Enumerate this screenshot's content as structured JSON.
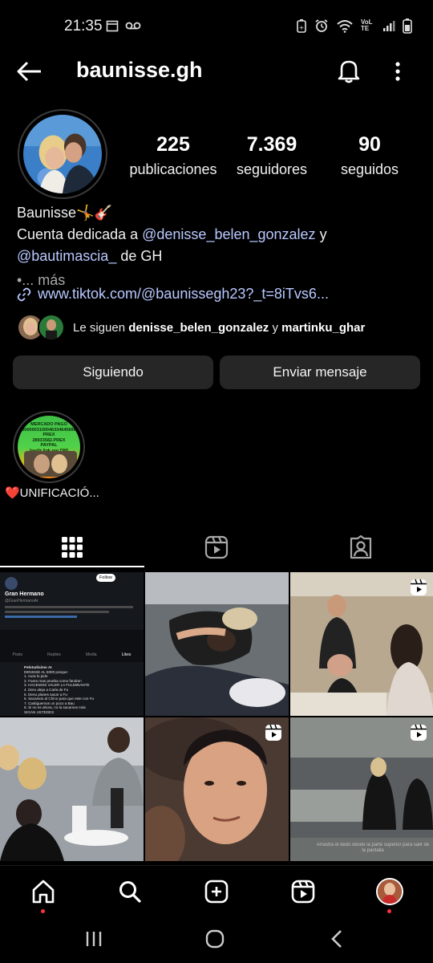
{
  "status_bar": {
    "time": "21:35",
    "network": "VoLTE"
  },
  "header": {
    "username": "baunisse.gh"
  },
  "profile": {
    "stats": [
      {
        "value": "225",
        "label": "publicaciones"
      },
      {
        "value": "7.369",
        "label": "seguidores"
      },
      {
        "value": "90",
        "label": "seguidos"
      }
    ],
    "bio": {
      "name": "Baunisse",
      "name_emoji": "🤸🎸",
      "line1_prefix": "Cuenta dedicada a ",
      "mention1": "@denisse_belen_gonzalez",
      "line1_suffix": " y",
      "mention2": "@bautimascia_",
      "line2_suffix": " de GH",
      "more": "•... más"
    },
    "link": "www.tiktok.com/@baunissegh23?_t=8iTvs6...",
    "followed_by": {
      "prefix": "Le siguen ",
      "user1": "denisse_belen_gonzalez",
      "conj": " y ",
      "user2": "martinku_ghar"
    },
    "buttons": {
      "following": "Siguiendo",
      "message": "Enviar mensaje"
    }
  },
  "highlight": {
    "label": "❤️UNIFICACIÓ...",
    "image_text": [
      "MERCADO PAGO",
      "0000003100046334645898",
      "PREX",
      "28933582.PREX",
      "PAYPAL",
      "(pedir link por DM)"
    ]
  },
  "grid": {
    "post1": {
      "account_name": "Gran Hermano",
      "handle": "@GranHermanoAr",
      "follow": "Follow",
      "tabs": [
        "Posts",
        "Replies",
        "Media",
        "Likes"
      ],
      "list_title": "Pelotudisimo AI",
      "list_lines": [
        "DENISSE AL 5000 porque:",
        "1. Aura lo pide",
        "2. Fuera mas prueba como fandom",
        "3. HACEMOS VALER LA FULMINANTE",
        "4. Deru aleja a Carla de Fu",
        "5. Denu planes sacar a Fu",
        "6. Sacamos al Chino para que este con Fu",
        "7. Castiguemos un poco a Bau",
        "8. Si no es ahora, no la sacamos más",
        "SIGAN USTEDES"
      ]
    },
    "post6_caption": "Arrastra el dedo desde la parte superior para salir de la pantalla"
  },
  "colors": {
    "background": "#000000",
    "button_bg": "#262626",
    "mention": "#b9c8ff",
    "notification_dot": "#ff3040"
  }
}
